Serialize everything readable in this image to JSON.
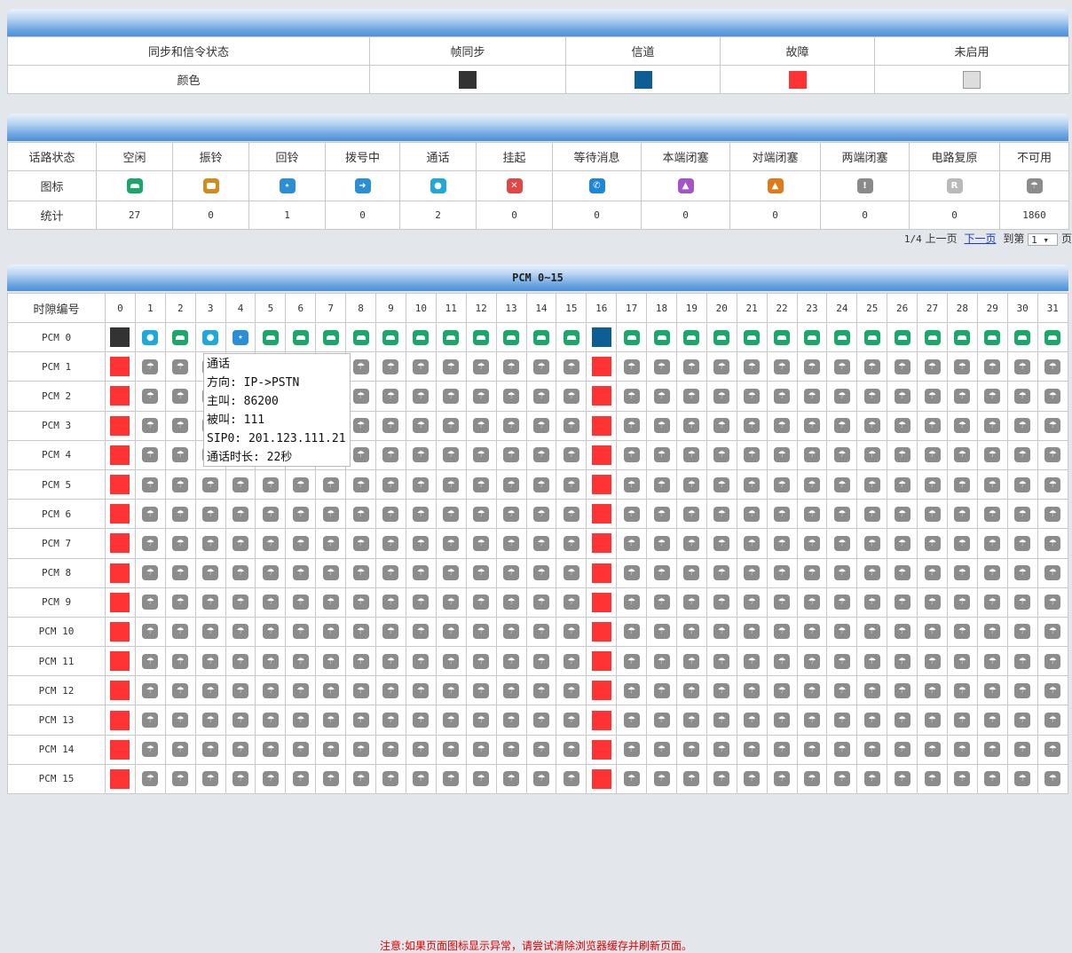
{
  "legend": {
    "header": "同步和信令状态",
    "color_label": "颜色",
    "states": [
      {
        "label": "帧同步",
        "color": "#333333"
      },
      {
        "label": "信道",
        "color": "#0e5e96"
      },
      {
        "label": "故障",
        "color": "#ff3333"
      },
      {
        "label": "未启用",
        "color": "#dddddd"
      }
    ]
  },
  "status": {
    "row_labels": [
      "话路状态",
      "图标",
      "统计"
    ],
    "items": [
      {
        "label": "空闲",
        "icon": "idle-icon",
        "count": "27"
      },
      {
        "label": "振铃",
        "icon": "ringing-icon",
        "count": "0"
      },
      {
        "label": "回铃",
        "icon": "ringback-icon",
        "count": "1"
      },
      {
        "label": "拨号中",
        "icon": "dialing-icon",
        "count": "0"
      },
      {
        "label": "通话",
        "icon": "talking-icon",
        "count": "2"
      },
      {
        "label": "挂起",
        "icon": "hangup-icon",
        "count": "0"
      },
      {
        "label": "等待消息",
        "icon": "wait-message-icon",
        "count": "0"
      },
      {
        "label": "本端闭塞",
        "icon": "local-block-icon",
        "count": "0"
      },
      {
        "label": "对端闭塞",
        "icon": "remote-block-icon",
        "count": "0"
      },
      {
        "label": "两端闭塞",
        "icon": "both-block-icon",
        "count": "0"
      },
      {
        "label": "电路复原",
        "icon": "circuit-reset-icon",
        "count": "0"
      },
      {
        "label": "不可用",
        "icon": "unavailable-icon",
        "count": "1860"
      }
    ]
  },
  "pager": {
    "page_info": "1/4",
    "prev": "上一页",
    "next": "下一页",
    "goto": "到第",
    "selected_page": "1",
    "page_suffix": "页"
  },
  "pcm": {
    "title": "PCM 0~15",
    "slot_header": "时隙编号",
    "slots": [
      "0",
      "1",
      "2",
      "3",
      "4",
      "5",
      "6",
      "7",
      "8",
      "9",
      "10",
      "11",
      "12",
      "13",
      "14",
      "15",
      "16",
      "17",
      "18",
      "19",
      "20",
      "21",
      "22",
      "23",
      "24",
      "25",
      "26",
      "27",
      "28",
      "29",
      "30",
      "31"
    ],
    "rows": [
      {
        "label": "PCM 0",
        "slots": [
          "F",
          "K",
          "I",
          "K",
          "R",
          "I",
          "I",
          "I",
          "I",
          "I",
          "I",
          "I",
          "I",
          "I",
          "I",
          "I",
          "C",
          "I",
          "I",
          "I",
          "I",
          "I",
          "I",
          "I",
          "I",
          "I",
          "I",
          "I",
          "I",
          "I",
          "I",
          "I"
        ]
      },
      {
        "label": "PCM 1"
      },
      {
        "label": "PCM 2"
      },
      {
        "label": "PCM 3"
      },
      {
        "label": "PCM 4"
      },
      {
        "label": "PCM 5"
      },
      {
        "label": "PCM 6"
      },
      {
        "label": "PCM 7"
      },
      {
        "label": "PCM 8"
      },
      {
        "label": "PCM 9"
      },
      {
        "label": "PCM 10"
      },
      {
        "label": "PCM 11"
      },
      {
        "label": "PCM 12"
      },
      {
        "label": "PCM 13"
      },
      {
        "label": "PCM 14"
      },
      {
        "label": "PCM 15"
      }
    ],
    "fault_row_pattern": [
      "X",
      "N",
      "N",
      "N",
      "N",
      "N",
      "N",
      "N",
      "N",
      "N",
      "N",
      "N",
      "N",
      "N",
      "N",
      "N",
      "X",
      "N",
      "N",
      "N",
      "N",
      "N",
      "N",
      "N",
      "N",
      "N",
      "N",
      "N",
      "N",
      "N",
      "N",
      "N"
    ]
  },
  "tooltip": {
    "lines": [
      "通话",
      "方向: IP->PSTN",
      "主叫: 86200",
      "被叫: 111",
      "SIP0: 201.123.111.21",
      "通话时长: 22秒"
    ]
  },
  "note": "注意:如果页面图标显示异常，请尝试清除浏览器缓存并刷新页面。"
}
